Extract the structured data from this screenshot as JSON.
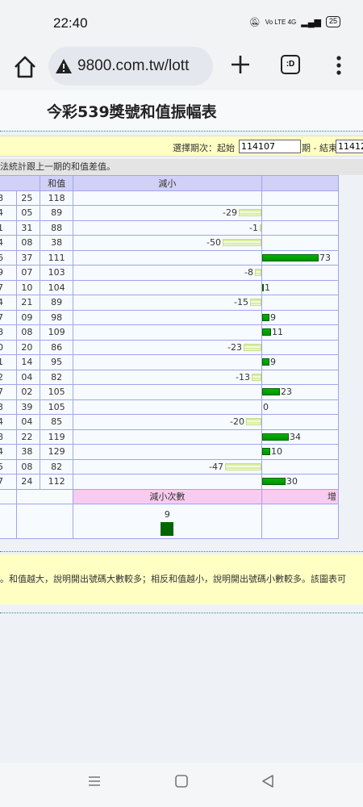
{
  "status": {
    "time": "22:40",
    "battery": "25",
    "net": "Vo LTE 4G"
  },
  "browser": {
    "url": "9800.com.tw/lott",
    "tabs_label": ":D"
  },
  "page": {
    "title": "今彩539獎號和值振幅表",
    "period": {
      "label": "選擇期次：起始",
      "start_value": "114107",
      "mid_label": "期 - 結束",
      "end_value": "11412"
    },
    "note": "法統計跟上一期的和值差值。",
    "table": {
      "headers": [
        "",
        "和值",
        "減小",
        ""
      ],
      "rows": [
        {
          "a": "8",
          "b": "25",
          "sum": "118",
          "diff": null
        },
        {
          "a": "4",
          "b": "05",
          "sum": "89",
          "diff": -29
        },
        {
          "a": "1",
          "b": "31",
          "sum": "88",
          "diff": -1
        },
        {
          "a": "4",
          "b": "08",
          "sum": "38",
          "diff": -50
        },
        {
          "a": "6",
          "b": "37",
          "sum": "111",
          "diff": 73
        },
        {
          "a": "9",
          "b": "07",
          "sum": "103",
          "diff": -8
        },
        {
          "a": "7",
          "b": "10",
          "sum": "104",
          "diff": 1
        },
        {
          "a": "4",
          "b": "21",
          "sum": "89",
          "diff": -15
        },
        {
          "a": "7",
          "b": "09",
          "sum": "98",
          "diff": 9
        },
        {
          "a": "8",
          "b": "08",
          "sum": "109",
          "diff": 11
        },
        {
          "a": "0",
          "b": "20",
          "sum": "86",
          "diff": -23
        },
        {
          "a": "1",
          "b": "14",
          "sum": "95",
          "diff": 9
        },
        {
          "a": "2",
          "b": "04",
          "sum": "82",
          "diff": -13
        },
        {
          "a": "7",
          "b": "02",
          "sum": "105",
          "diff": 23
        },
        {
          "a": "3",
          "b": "39",
          "sum": "105",
          "diff": 0
        },
        {
          "a": "4",
          "b": "04",
          "sum": "85",
          "diff": -20
        },
        {
          "a": "8",
          "b": "22",
          "sum": "119",
          "diff": 34
        },
        {
          "a": "4",
          "b": "38",
          "sum": "129",
          "diff": 10
        },
        {
          "a": "5",
          "b": "08",
          "sum": "82",
          "diff": -47
        },
        {
          "a": "7",
          "b": "24",
          "sum": "112",
          "diff": 30
        }
      ],
      "summary_header": "減小次數",
      "summary_right": "增",
      "decrease_count": "9"
    },
    "description": "。和值越大，說明開出號碼大數較多；相反和值越小，說明開出號碼小數較多。該圖表可"
  }
}
